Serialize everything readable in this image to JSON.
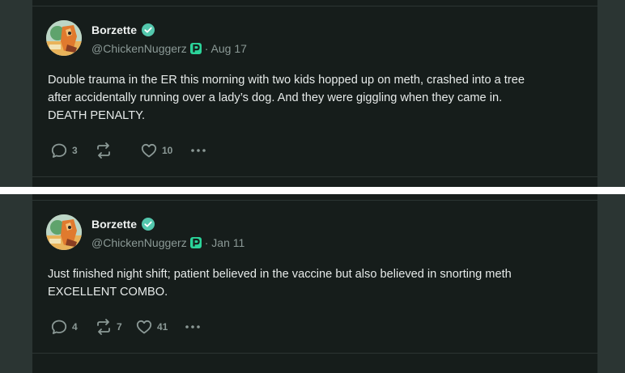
{
  "posts": [
    {
      "author": "Borzette",
      "handle": "@ChickenNuggerz",
      "separator": "·",
      "date": "Aug 17",
      "lines": [
        "Double trauma in the ER this morning with two kids hopped up on meth, crashed into a tree",
        "after accidentally running over a lady’s dog. And they were giggling when they came in.",
        "DEATH PENALTY."
      ],
      "replies": "3",
      "reposts": "",
      "likes": "10"
    },
    {
      "author": "Borzette",
      "handle": "@ChickenNuggerz",
      "separator": "·",
      "date": "Jan 11",
      "lines": [
        "Just finished night shift; patient believed in the vaccine but also believed in snorting meth",
        "EXCELLENT COMBO."
      ],
      "replies": "4",
      "reposts": "7",
      "likes": "41"
    }
  ],
  "colors": {
    "background": "#161d1b",
    "side": "#2b3533",
    "verified": "#53c7ad",
    "badge": "#2bd49a"
  },
  "icons": [
    "avatar-illustration",
    "verified-check-icon",
    "p-badge-icon",
    "reply-icon",
    "repost-icon",
    "like-icon",
    "more-icon"
  ]
}
